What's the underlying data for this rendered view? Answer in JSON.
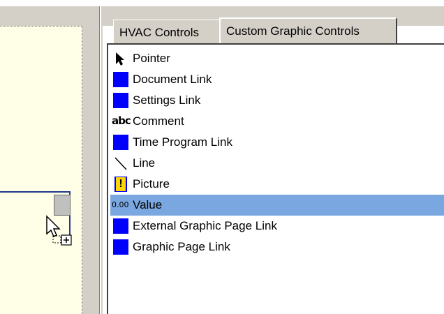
{
  "tabs": [
    {
      "label": "HVAC Controls",
      "active": false
    },
    {
      "label": "Custom Graphic Controls",
      "active": true
    }
  ],
  "toolbox": {
    "items": [
      {
        "label": "Pointer",
        "icon": "pointer-arrow-icon"
      },
      {
        "label": "Document Link",
        "icon": "blue-square-icon"
      },
      {
        "label": "Settings Link",
        "icon": "blue-square-icon"
      },
      {
        "label": "Comment",
        "icon": "abc-text-icon"
      },
      {
        "label": "Time Program Link",
        "icon": "blue-square-icon"
      },
      {
        "label": "Line",
        "icon": "diagonal-line-icon"
      },
      {
        "label": "Picture",
        "icon": "exclamation-picture-icon"
      },
      {
        "label": "Value",
        "icon": "zero-value-icon",
        "selected": true
      },
      {
        "label": "External Graphic Page Link",
        "icon": "blue-square-icon"
      },
      {
        "label": "Graphic Page Link",
        "icon": "blue-square-icon"
      }
    ],
    "icon_text": {
      "comment": "abc",
      "value": "0.00",
      "picture": "!"
    }
  },
  "colors": {
    "selection": "#7aa7e0",
    "link_square": "#0000ff",
    "canvas": "#ffffe8",
    "chrome": "#d4d0c8"
  }
}
